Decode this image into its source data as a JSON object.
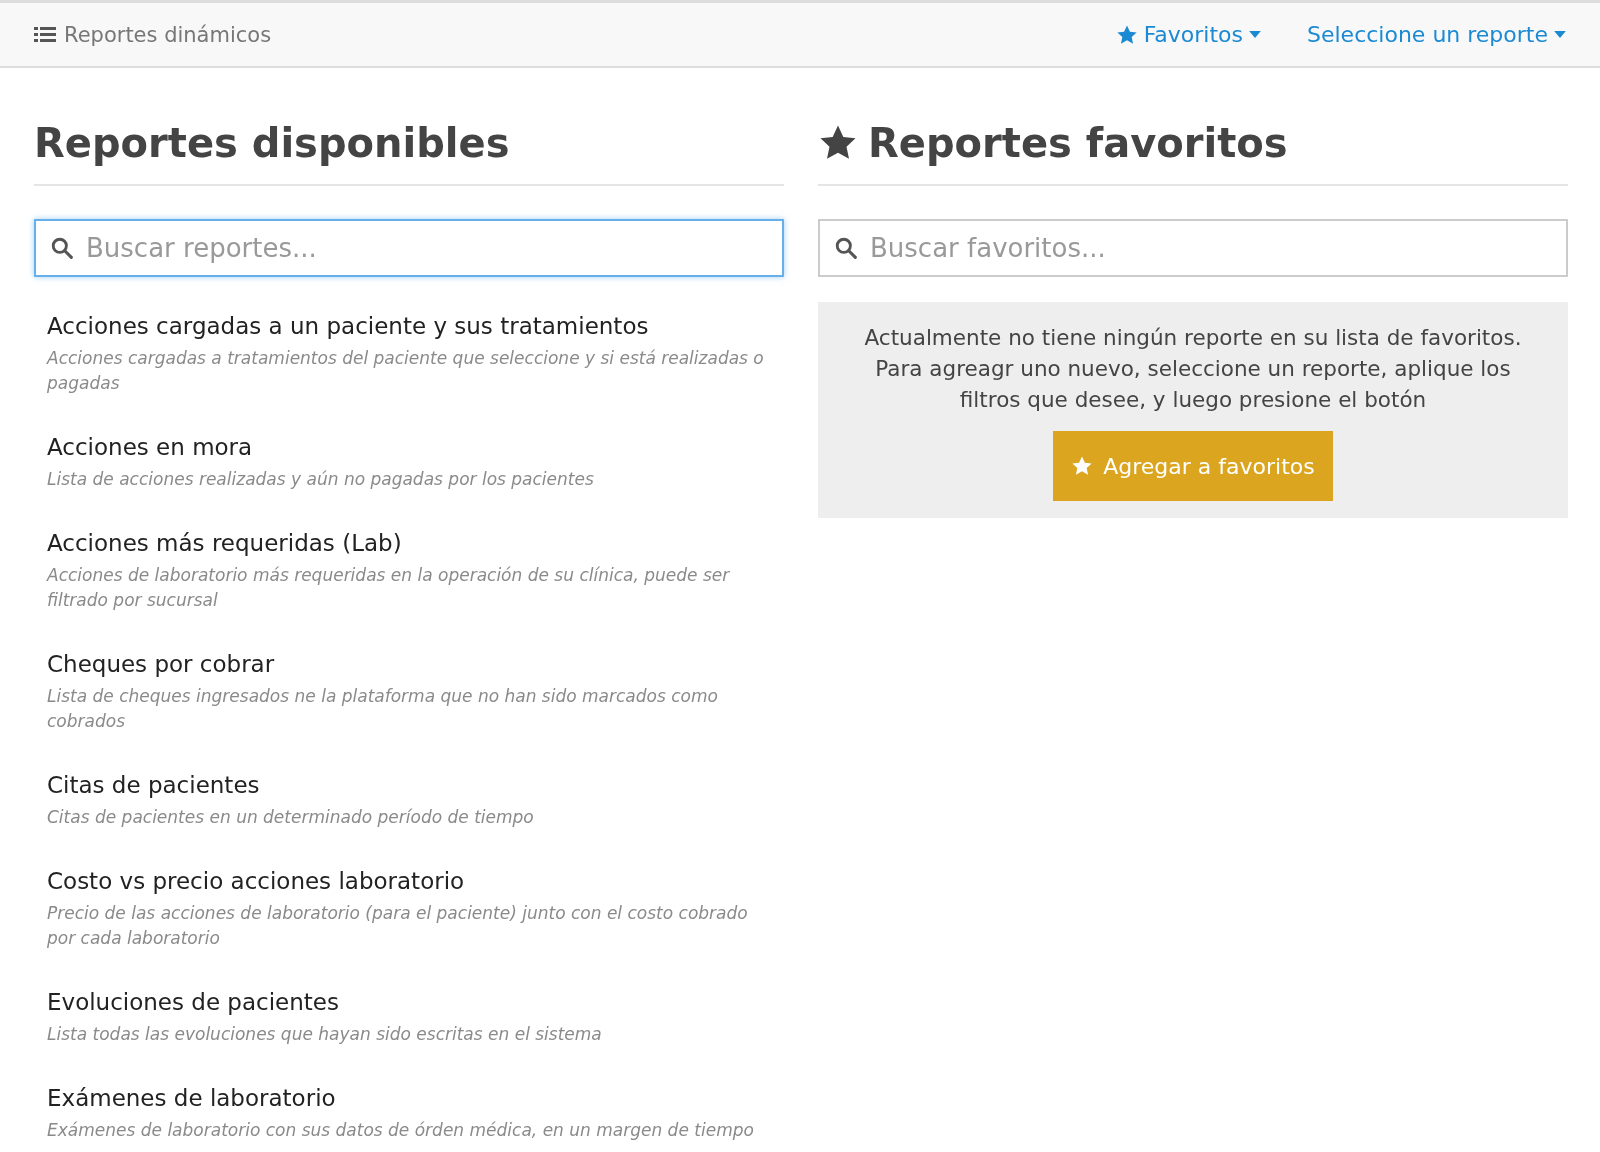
{
  "navbar": {
    "title": "Reportes dinámicos",
    "menus": [
      {
        "label": "Favoritos",
        "kind": "star"
      },
      {
        "label": "Seleccione un reporte",
        "kind": "plain"
      }
    ]
  },
  "available": {
    "heading": "Reportes disponibles",
    "search": {
      "placeholder": "Buscar reportes...",
      "focused": true
    },
    "reports": [
      {
        "title": "Acciones cargadas a un paciente y sus tratamientos",
        "description": "Acciones cargadas a tratamientos del paciente que seleccione y si está realizadas o pagadas"
      },
      {
        "title": "Acciones en mora",
        "description": "Lista de acciones realizadas y aún no pagadas por los pacientes"
      },
      {
        "title": "Acciones más requeridas (Lab)",
        "description": "Acciones de laboratorio más requeridas en la operación de su clínica, puede ser filtrado por sucursal"
      },
      {
        "title": "Cheques por cobrar",
        "description": "Lista de cheques ingresados ne la plataforma que no han sido marcados como cobrados"
      },
      {
        "title": "Citas de pacientes",
        "description": "Citas de pacientes en un determinado período de tiempo"
      },
      {
        "title": "Costo vs precio acciones laboratorio",
        "description": "Precio de las acciones de laboratorio (para el paciente) junto con el costo cobrado por cada laboratorio"
      },
      {
        "title": "Evoluciones de pacientes",
        "description": "Lista todas las evoluciones que hayan sido escritas en el sistema"
      },
      {
        "title": "Exámenes de laboratorio",
        "description": "Exámenes de laboratorio con sus datos de órden médica, en un margen de tiempo"
      }
    ]
  },
  "favorites": {
    "heading": "Reportes favoritos",
    "search": {
      "placeholder": "Buscar favoritos...",
      "focused": false
    },
    "empty_message": "Actualmente no tiene ningún reporte en su lista de favoritos. Para agreagr uno nuevo, seleccione un reporte, aplique los filtros que desee, y luego presione el botón",
    "button": "Agregar a favoritos"
  }
}
